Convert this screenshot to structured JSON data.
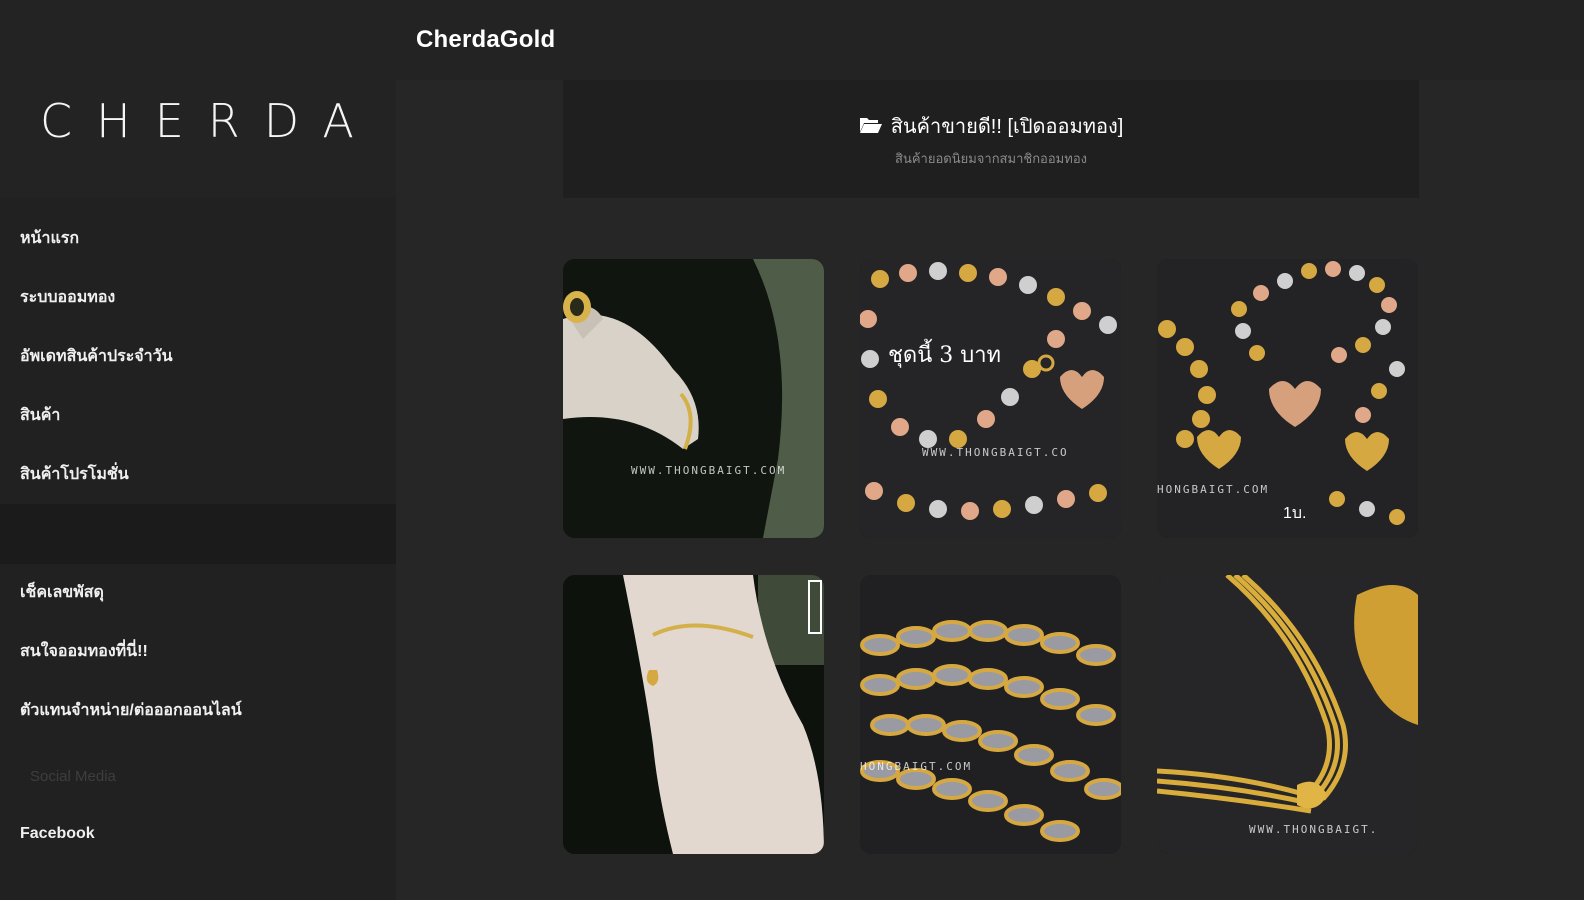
{
  "header": {
    "site_title": "CherdaGold"
  },
  "sidebar": {
    "logo": "CHERDA",
    "items": [
      {
        "label": "หน้าแรก"
      },
      {
        "label": "ระบบออมทอง"
      },
      {
        "label": "อัพเดทสินค้าประจำวัน"
      },
      {
        "label": "สินค้า"
      },
      {
        "label": "สินค้าโปรโมชั่น"
      },
      {
        "label": ""
      },
      {
        "label": "เช็คเลขพัสดุ"
      },
      {
        "label": "สนใจออมทองที่นี่!!"
      },
      {
        "label": "ตัวแทนจำหน่าย/ต่อออกออนไลน์"
      }
    ],
    "section_social": "Social Media",
    "social": [
      {
        "label": "Facebook"
      }
    ]
  },
  "category": {
    "title": "สินค้าขายดี!! [เปิดออมทอง]",
    "subtitle": "สินค้ายอดนิยมจากสมาชิกออมทอง",
    "folder_icon": "folder-open-icon"
  },
  "products": [
    {
      "watermark": "WWW.THONGBAIGT.COM",
      "caption": ""
    },
    {
      "watermark": "WWW.THONGBAIGT.CO",
      "caption": "ชุดนี้ 3 บาท"
    },
    {
      "watermark": "HONGBAIGT.COM",
      "caption": "1บ."
    },
    {
      "watermark": "",
      "caption": ""
    },
    {
      "watermark": "HONGBAIGT.COM",
      "caption": ""
    },
    {
      "watermark": "WWW.THONGBAIGT.",
      "caption": ""
    }
  ],
  "colors": {
    "background": "#262626",
    "sidebar": "#212121",
    "topbar": "#232323",
    "gold": "#d4a437",
    "text": "#ffffff"
  }
}
